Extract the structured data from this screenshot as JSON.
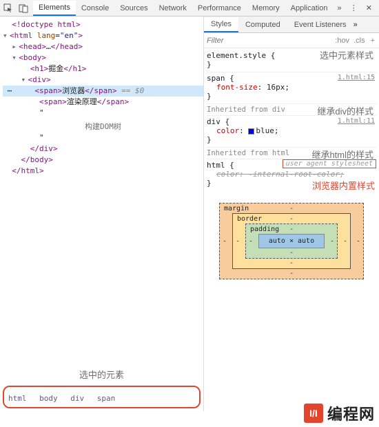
{
  "tabs": {
    "elements": "Elements",
    "console": "Console",
    "sources": "Sources",
    "network": "Network",
    "performance": "Performance",
    "memory": "Memory",
    "application": "Application"
  },
  "dom": {
    "doctype": "<!doctype html>",
    "html_open": "<html lang=\"en\">",
    "head": "<head>…</head>",
    "body_open": "<body>",
    "h1": "<h1>掘金</h1>",
    "div_open": "<div>",
    "span1_open": "<span>",
    "span1_text": "浏览器",
    "span1_close": "</span>",
    "eqdol": " == $0",
    "span2_open": "<span>",
    "span2_text": "渲染原理",
    "span2_close": "</span>",
    "quote": "\"",
    "center_text": "构建DOM树",
    "div_close": "</div>",
    "body_close": "</body>",
    "html_close": "</html>"
  },
  "annot": {
    "selected_element": "选中的元素",
    "selected_style": "选中元素样式",
    "inherit_div": "继承div的样式",
    "inherit_html": "继承html的样式",
    "builtin": "浏览器内置样式"
  },
  "crumbs": [
    "html",
    "body",
    "div",
    "span"
  ],
  "subtabs": {
    "styles": "Styles",
    "computed": "Computed",
    "eventlisteners": "Event Listeners"
  },
  "filter": {
    "placeholder": "Filter",
    "hov": ":hov",
    "cls": ".cls"
  },
  "rules": {
    "elstyle": "element.style {",
    "span_sel": "span {",
    "span_prop": "font-size",
    "span_val": "16px;",
    "span_link": "1.html:15",
    "inh_div": "Inherited from ",
    "inh_div_src": "div",
    "div_sel": "div {",
    "div_prop": "color",
    "div_val": "blue;",
    "div_link": "1.html:11",
    "inh_html": "Inherited from ",
    "inh_html_src": "html",
    "html_sel": "html {",
    "uas": "user agent stylesheet",
    "html_prop": "color",
    "html_val": "-internal-root-color;",
    "close": "}"
  },
  "boxmodel": {
    "margin": "margin",
    "border": "border",
    "padding": "padding",
    "content": "auto × auto",
    "dash": "-"
  },
  "logo": {
    "mark": "I/I",
    "text": "编程网"
  }
}
